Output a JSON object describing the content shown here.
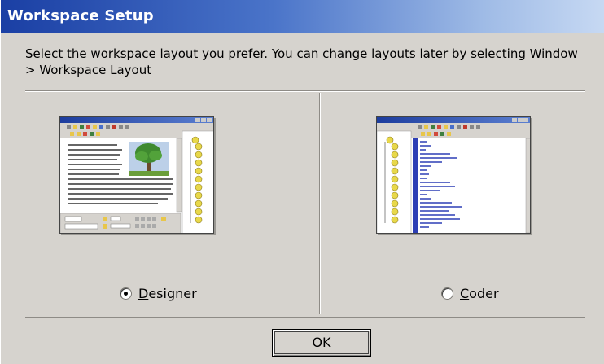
{
  "dialog": {
    "title": "Workspace Setup",
    "instructions": "Select the workspace layout you prefer. You can change layouts later by selecting Window > Workspace Layout"
  },
  "options": [
    {
      "id": "designer",
      "label": "Designer",
      "mnemonic": "D",
      "rest": "esigner",
      "selected": true
    },
    {
      "id": "coder",
      "label": "Coder",
      "mnemonic": "C",
      "rest": "oder",
      "selected": false
    }
  ],
  "ok_label": "OK",
  "colors": {
    "title_bar_start": "#1a3fa4",
    "title_bar_end": "#c7d9f3",
    "dialog_face": "#d6d3ce",
    "code_text": "#2d3fb5"
  }
}
